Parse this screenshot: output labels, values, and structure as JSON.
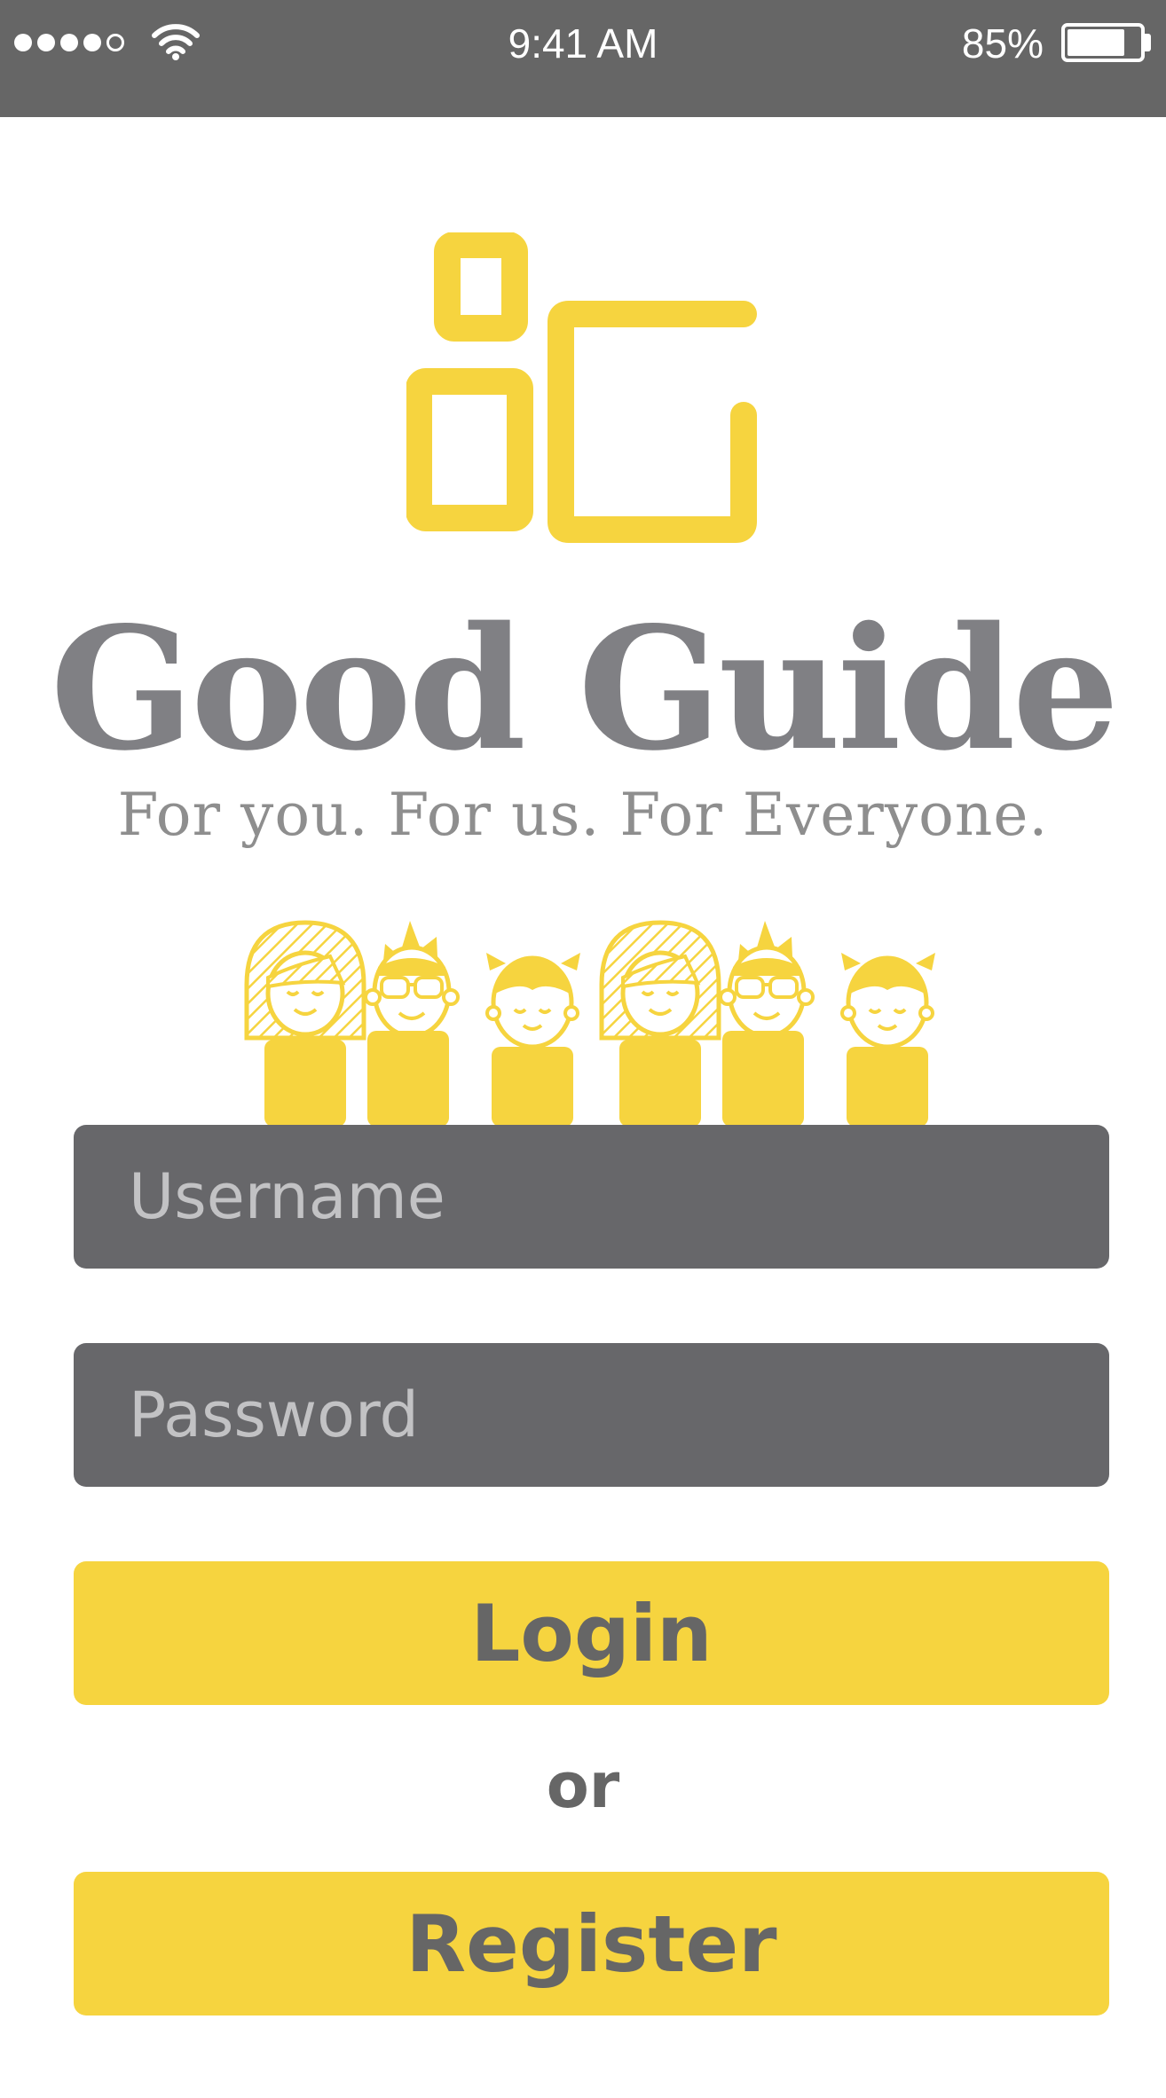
{
  "status_bar": {
    "time": "9:41 AM",
    "battery_percent": "85%",
    "battery_level": 0.85,
    "signal_bars_filled": 4,
    "signal_bars_total": 5,
    "icons": [
      "signal-dots-icon",
      "wifi-icon",
      "battery-icon"
    ]
  },
  "brand": {
    "name": "Good Guide",
    "tagline": "For you. For us. For Everyone.",
    "accent_color": "#f6d43f",
    "text_color": "#808084",
    "logo_icon": "good-guide-logo-icon",
    "illustration": "family-people-illustration"
  },
  "form": {
    "username_placeholder": "Username",
    "password_placeholder": "Password",
    "login_label": "Login",
    "or_label": "or",
    "register_label": "Register",
    "field_color": "#67676a"
  }
}
